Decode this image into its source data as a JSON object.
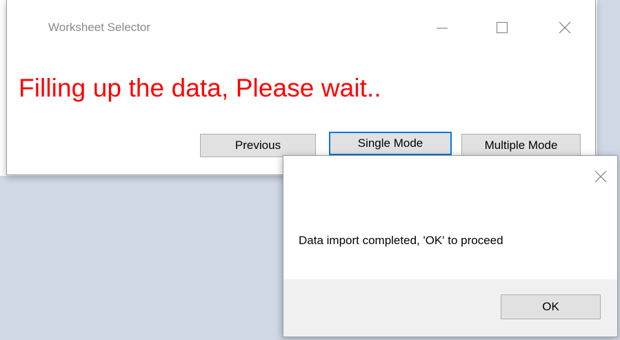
{
  "main_window": {
    "title": "Worksheet Selector",
    "status_message": "Filling up the data, Please wait..",
    "status_color": "#ff0000",
    "buttons": {
      "previous": "Previous",
      "single_mode": "Single Mode",
      "multiple_mode": "Multiple Mode"
    },
    "caption_icons": [
      "minimize-icon",
      "maximize-icon",
      "close-icon"
    ]
  },
  "dialog": {
    "message": "Data import completed, 'OK' to proceed",
    "ok_label": "OK",
    "close_icon": "close-icon"
  },
  "colors": {
    "desktop_background": "#d0d8e6",
    "focus_border": "#0078d7",
    "button_face": "#e1e1e1"
  }
}
